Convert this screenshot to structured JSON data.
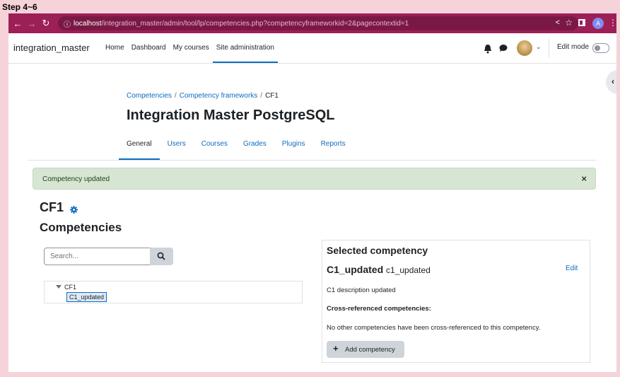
{
  "step_label": "Step 4~6",
  "browser": {
    "url_host": "localhost",
    "url_path": "/integration_master/admin/tool/lp/competencies.php?competencyframeworkid=2&pagecontextid=1",
    "profile_initial": "A"
  },
  "topnav": {
    "brand": "integration_master",
    "links": [
      "Home",
      "Dashboard",
      "My courses",
      "Site administration"
    ],
    "active_link": "Site administration",
    "edit_mode_label": "Edit mode"
  },
  "breadcrumb": {
    "items": [
      "Competencies",
      "Competency frameworks",
      "CF1"
    ],
    "separator": "/"
  },
  "page_title": "Integration Master PostgreSQL",
  "tabs": [
    "General",
    "Users",
    "Courses",
    "Grades",
    "Plugins",
    "Reports"
  ],
  "active_tab": "General",
  "alert": {
    "text": "Competency updated",
    "close": "×"
  },
  "framework_heading": "CF1",
  "competencies_heading": "Competencies",
  "search": {
    "placeholder": "Search..."
  },
  "tree": {
    "root": "CF1",
    "child": "C1_updated"
  },
  "selected": {
    "title": "Selected competency",
    "name": "C1_updated",
    "idnumber": "c1_updated",
    "edit_label": "Edit",
    "description": "C1 description updated",
    "xref_heading": "Cross-referenced competencies:",
    "xref_none": "No other competencies have been cross-referenced to this competency.",
    "add_button": "Add competency"
  },
  "colors": {
    "browser_bar": "#9c1f56",
    "link": "#0f6cbf",
    "alert_bg": "#d7e6d3",
    "page_bg": "#f6d3d8"
  }
}
